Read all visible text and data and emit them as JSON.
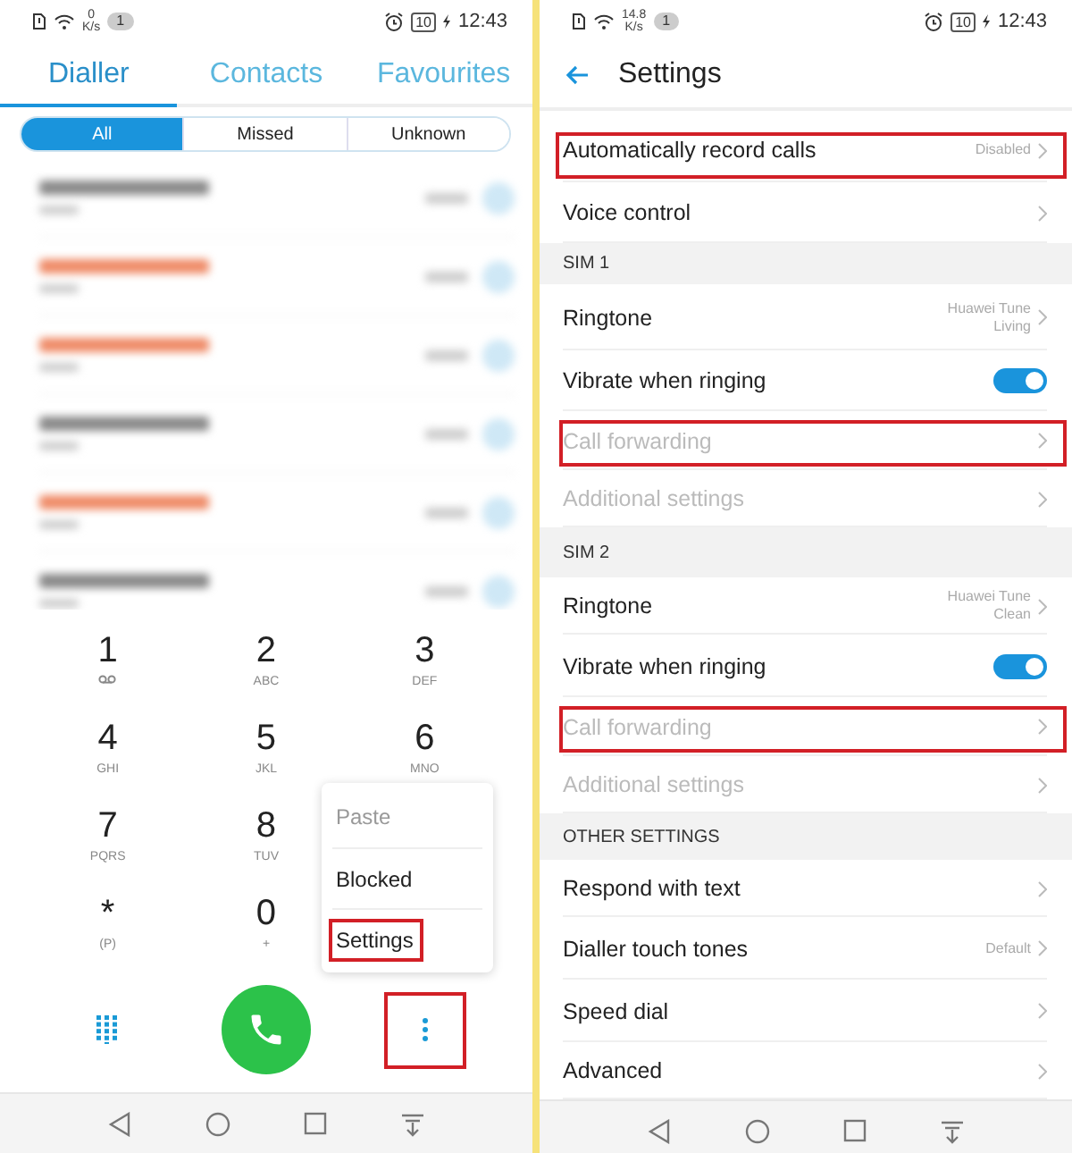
{
  "dialler_screen": {
    "status_bar": {
      "speed": "0",
      "speed_unit": "K/s",
      "notification_count": "1",
      "battery": "10",
      "time": "12:43"
    },
    "tabs": [
      {
        "label": "Dialler",
        "selected": true
      },
      {
        "label": "Contacts",
        "selected": false
      },
      {
        "label": "Favourites",
        "selected": false
      }
    ],
    "filters": [
      {
        "label": "All",
        "selected": true
      },
      {
        "label": "Missed",
        "selected": false
      },
      {
        "label": "Unknown",
        "selected": false
      }
    ],
    "call_log": [
      {
        "missed": false
      },
      {
        "missed": true
      },
      {
        "missed": true
      },
      {
        "missed": false
      },
      {
        "missed": true
      },
      {
        "missed": false
      }
    ],
    "keypad_rows": [
      [
        {
          "kind": "voicemail",
          "digit": "1"
        },
        {
          "kind": "letters",
          "digit": "2",
          "letters": "ABC"
        },
        {
          "kind": "letters",
          "digit": "3",
          "letters": "DEF"
        }
      ],
      [
        {
          "kind": "letters",
          "digit": "4",
          "letters": "GHI"
        },
        {
          "kind": "letters",
          "digit": "5",
          "letters": "JKL"
        },
        {
          "kind": "letters",
          "digit": "6",
          "letters": "MNO"
        }
      ],
      [
        {
          "kind": "letters",
          "digit": "7",
          "letters": "PQRS"
        },
        {
          "kind": "letters",
          "digit": "8",
          "letters": "TUV"
        }
      ],
      [
        {
          "kind": "letters",
          "digit": "*",
          "letters": "(P)"
        },
        {
          "kind": "letters",
          "digit": "0",
          "letters": "+"
        }
      ]
    ],
    "menu": [
      {
        "label": "Paste",
        "disabled": true,
        "highlighted": false
      },
      {
        "label": "Blocked",
        "disabled": false,
        "highlighted": false
      },
      {
        "label": "Settings",
        "disabled": false,
        "highlighted": true
      }
    ],
    "more_button": {
      "highlighted": true
    }
  },
  "settings_screen": {
    "status_bar": {
      "speed": "14.8",
      "speed_unit": "K/s",
      "notification_count": "1",
      "battery": "10",
      "time": "12:43"
    },
    "title": "Settings",
    "items": [
      {
        "kind": "row",
        "label": "Automatically record calls",
        "value": "Disabled",
        "disabled": false,
        "highlighted": true
      },
      {
        "kind": "row",
        "label": "Voice control",
        "disabled": false,
        "highlighted": false
      },
      {
        "kind": "header",
        "label": "SIM 1"
      },
      {
        "kind": "row",
        "label": "Ringtone",
        "value": "Huawei Tune Living",
        "disabled": false,
        "highlighted": false
      },
      {
        "kind": "toggle",
        "label": "Vibrate when ringing",
        "on": true
      },
      {
        "kind": "row",
        "label": "Call forwarding",
        "disabled": true,
        "highlighted": true
      },
      {
        "kind": "row",
        "label": "Additional settings",
        "disabled": true,
        "highlighted": false
      },
      {
        "kind": "header",
        "label": "SIM 2"
      },
      {
        "kind": "row",
        "label": "Ringtone",
        "value": "Huawei Tune Clean",
        "disabled": false,
        "highlighted": false
      },
      {
        "kind": "toggle",
        "label": "Vibrate when ringing",
        "on": true
      },
      {
        "kind": "row",
        "label": "Call forwarding",
        "disabled": true,
        "highlighted": true
      },
      {
        "kind": "row",
        "label": "Additional settings",
        "disabled": true,
        "highlighted": false
      },
      {
        "kind": "header",
        "label": "OTHER SETTINGS"
      },
      {
        "kind": "row",
        "label": "Respond with text",
        "disabled": false,
        "highlighted": false
      },
      {
        "kind": "row",
        "label": "Dialler touch tones",
        "value": "Default",
        "disabled": false,
        "highlighted": false
      },
      {
        "kind": "row",
        "label": "Speed dial",
        "disabled": false,
        "highlighted": false
      },
      {
        "kind": "row",
        "label": "Advanced",
        "disabled": false,
        "highlighted": false
      }
    ]
  }
}
